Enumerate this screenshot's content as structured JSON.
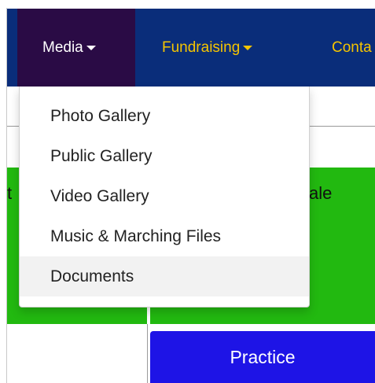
{
  "navbar": {
    "items": [
      {
        "label": "Media",
        "active": true
      },
      {
        "label": "Fundraising"
      },
      {
        "label": "Conta"
      }
    ]
  },
  "dropdown": {
    "items": [
      {
        "label": "Photo Gallery"
      },
      {
        "label": "Public Gallery"
      },
      {
        "label": "Video Gallery"
      },
      {
        "label": "Music & Marching Files"
      },
      {
        "label": "Documents",
        "hovered": true
      }
    ]
  },
  "content": {
    "left_fragment": "t",
    "right_fragment": "ale",
    "practice_label": "Practice"
  },
  "colors": {
    "navbar_bg": "#0a2d7a",
    "media_active_bg": "#2a0b45",
    "nav_link": "#f5c400",
    "green": "#22b910",
    "practice_btn": "#1e14e6"
  }
}
